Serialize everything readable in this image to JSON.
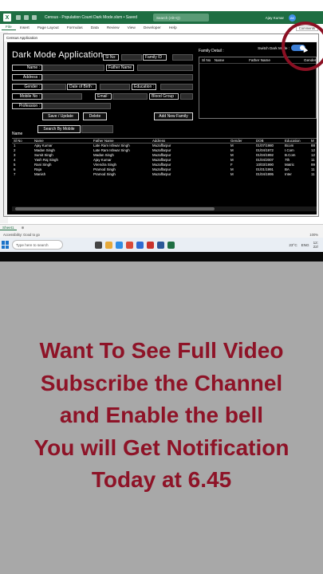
{
  "window": {
    "doc_title": "Census - Population Count Dark Mode.xlsm • Saved",
    "search_placeholder": "Search (Alt+Q)",
    "user_name": "Ajay Kumar",
    "user_initials": "AK"
  },
  "ribbon": {
    "tabs": [
      "File",
      "Insert",
      "Page Layout",
      "Formulas",
      "Data",
      "Review",
      "View",
      "Developer",
      "Help"
    ],
    "comments_label": "Comments"
  },
  "dialog": {
    "title": "Census Application",
    "app_title": "Dark Mode Application",
    "switch_label": "Switch Dark Mode :",
    "labels": {
      "sl_no": "Sl No:",
      "family_id": "Family ID :",
      "name": "Name :",
      "father_name": "Father Name",
      "address": "Address :",
      "gender": "Gender :",
      "dob": "Date of Birth :",
      "education": "Education :",
      "mobile": "Mobile No :",
      "email": "Email :",
      "blood_group": "Blood Group :",
      "profession": "Profession :",
      "family_detail": "Family Detail :",
      "name_list": "Name"
    },
    "buttons": {
      "save": "Save / Update",
      "delete": "Delete",
      "add_family": "Add New Family",
      "search_mobile": "Search By Mobile"
    },
    "family_columns": [
      "Sl No",
      "Name",
      "Father Name",
      "Gender"
    ],
    "grid_columns": [
      "Sl No",
      "Name",
      "Father Name",
      "Address",
      "Gender",
      "DOB",
      "Education",
      "M"
    ],
    "grid_rows": [
      [
        "1",
        "Ajay Kumar",
        "Late Ram Ishwar Singh",
        "Muzaffarpur",
        "M",
        "01/07/1980",
        "Bcom",
        "88"
      ],
      [
        "2",
        "Madan Singh",
        "Late Ram Ishwar Singh",
        "Muzaffarpur",
        "M",
        "01/04/1972",
        "I.Com",
        "12"
      ],
      [
        "3",
        "Sumit Singh",
        "Madan Singh",
        "Muzaffarpur",
        "M",
        "01/04/1992",
        "B.Com",
        "12"
      ],
      [
        "4",
        "Yash Raj Singh",
        "Ajay Kumar",
        "Muzaffarpur",
        "M",
        "01/04/2007",
        "7th",
        "11"
      ],
      [
        "5",
        "Rani Singh",
        "Virendra Singh",
        "Muzaffarpur",
        "F",
        "10/03/1990",
        "Matric",
        "99"
      ],
      [
        "6",
        "Raja",
        "Pramod Singh",
        "Muzaffarpur",
        "M",
        "01/01/1991",
        "BA",
        "11"
      ],
      [
        "7",
        "Manish",
        "Pramod Singh",
        "Muzaffarpur",
        "M",
        "01/04/1995",
        "Inter",
        "11"
      ]
    ]
  },
  "sheet": {
    "tab": "Sheet1",
    "status": "Accessibility: Good to go",
    "zoom": "100%"
  },
  "taskbar": {
    "search_placeholder": "Type here to search",
    "temperature": "23°C",
    "lang": "ENG",
    "time": "12:",
    "date": "22/"
  },
  "caption": {
    "lines": [
      "Want To See Full Video",
      "Subscribe the Channel",
      "and Enable the bell",
      "You will Get Notification",
      "Today at 6.45"
    ]
  },
  "colors": {
    "excel_green": "#1e6e42",
    "caption_red": "#8e1327",
    "toggle_blue": "#3d7fd6",
    "background_gray": "#a8a8a8"
  }
}
